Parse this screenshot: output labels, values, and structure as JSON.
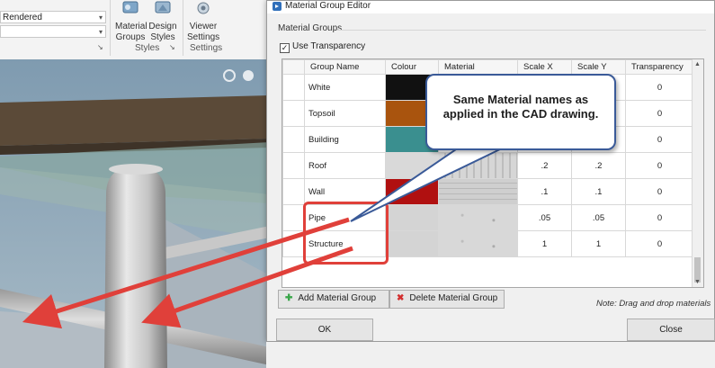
{
  "ribbon": {
    "render_mode": "Rendered",
    "second_select": "",
    "buttons": [
      {
        "label": "Material\nGroups",
        "icon": "material-groups-icon"
      },
      {
        "label": "Design\nStyles",
        "icon": "design-styles-icon"
      },
      {
        "label": "Viewer\nSettings",
        "icon": "viewer-settings-icon"
      }
    ],
    "group_styles": "Styles",
    "group_settings": "Settings"
  },
  "dialog": {
    "title": "Material Group Editor",
    "groupbox_label": "Material Groups",
    "use_transparency_label": "Use Transparency",
    "use_transparency_checked": true,
    "columns": [
      "Group Name",
      "Colour",
      "Material",
      "Scale X",
      "Scale Y",
      "Transparency"
    ],
    "rows": [
      {
        "name": "White",
        "colour": "#111111",
        "material": "none",
        "scale_x": "",
        "scale_y": "",
        "transparency": "0"
      },
      {
        "name": "Topsoil",
        "colour": "#a9540e",
        "material": "none",
        "scale_x": "",
        "scale_y": "",
        "transparency": "0"
      },
      {
        "name": "Building",
        "colour": "#3a8f8f",
        "material": "none",
        "scale_x": "",
        "scale_y": "",
        "transparency": "0"
      },
      {
        "name": "Roof",
        "colour": "#d9d9d9",
        "material": "roof",
        "scale_x": ".2",
        "scale_y": ".2",
        "transparency": "0"
      },
      {
        "name": "Wall",
        "colour": "#b01010",
        "material": "wall",
        "scale_x": ".1",
        "scale_y": ".1",
        "transparency": "0"
      },
      {
        "name": "Pipe",
        "colour": "#d4d4d4",
        "material": "concrete",
        "scale_x": ".05",
        "scale_y": ".05",
        "transparency": "0"
      },
      {
        "name": "Structure",
        "colour": "#d4d4d4",
        "material": "concrete",
        "scale_x": "1",
        "scale_y": "1",
        "transparency": "0"
      }
    ],
    "add_button": "Add Material Group",
    "delete_button": "Delete Material Group",
    "note": "Note: Drag and drop materials",
    "ok_button": "OK",
    "close_button": "Close"
  },
  "callout": {
    "line1": "Same Material names as",
    "line2": "applied in the CAD drawing."
  },
  "colors": {
    "annotation_red": "#e0403a",
    "callout_border": "#3a5a98",
    "add_icon": "#3aa64a",
    "delete_icon": "#d32f2f"
  }
}
